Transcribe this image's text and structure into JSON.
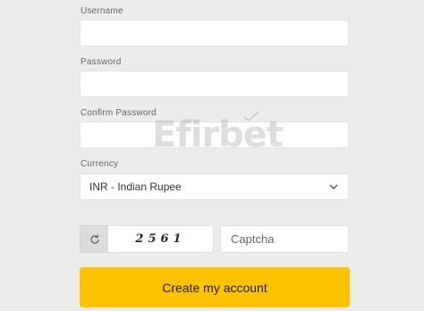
{
  "form": {
    "username": {
      "label": "Username",
      "value": ""
    },
    "password": {
      "label": "Password",
      "value": ""
    },
    "confirm_password": {
      "label": "Confirm Password",
      "value": ""
    },
    "currency": {
      "label": "Currency",
      "selected": "INR - Indian Rupee"
    },
    "captcha": {
      "code": "2561",
      "placeholder": "Captcha",
      "refresh_icon": "refresh-icon"
    },
    "submit_label": "Create my account"
  },
  "watermark": {
    "text": "Efirbet"
  },
  "colors": {
    "background": "#ececec",
    "accent": "#fdc300",
    "input_bg": "#ffffff"
  }
}
